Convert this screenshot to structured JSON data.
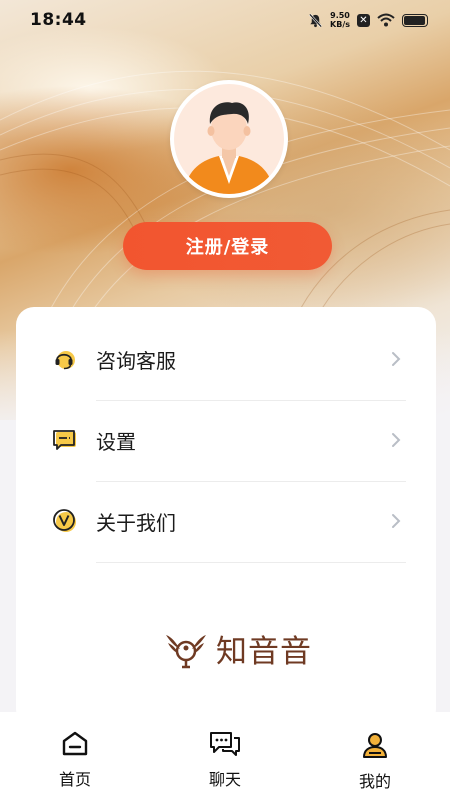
{
  "status_bar": {
    "time": "18:44",
    "net_speed_value": "9.50",
    "net_speed_unit": "KB/s",
    "x_badge": "✕",
    "battery_level": 0.95
  },
  "profile": {
    "login_button": "注册/登录"
  },
  "menu": {
    "items": [
      {
        "label": "咨询客服",
        "icon": "headset-icon"
      },
      {
        "label": "设置",
        "icon": "settings-chat-icon"
      },
      {
        "label": "关于我们",
        "icon": "v-badge-icon"
      }
    ]
  },
  "brand": {
    "logo_text": "知音音"
  },
  "tabs": [
    {
      "label": "首页",
      "icon": "home-icon"
    },
    {
      "label": "聊天",
      "icon": "chat-icon"
    },
    {
      "label": "我的",
      "icon": "profile-icon",
      "active": true
    }
  ],
  "colors": {
    "accent": "#f2552f",
    "icon_yellow": "#f7c948",
    "brand_brown": "#6f3a23"
  }
}
